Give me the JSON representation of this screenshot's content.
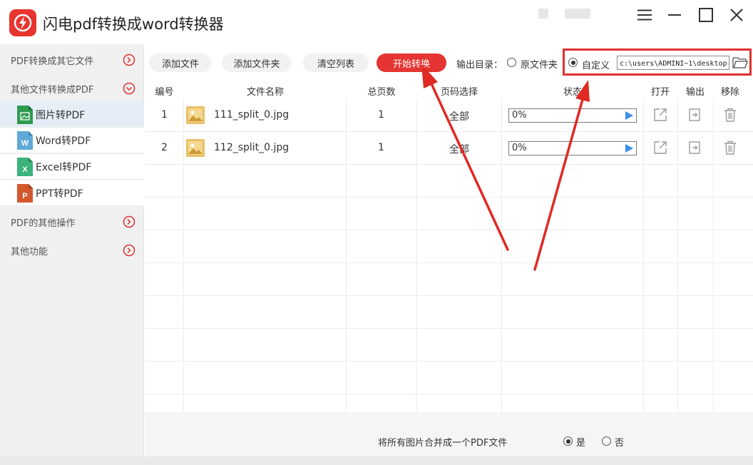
{
  "app": {
    "title": "闪电pdf转换成word转换器",
    "accent_color": "#e43532",
    "window_controls": [
      "menu-icon",
      "minimize-icon",
      "maximize-icon",
      "close-icon"
    ]
  },
  "sidebar": {
    "categories": [
      {
        "label": "PDF转换成其它文件",
        "expanded": false
      },
      {
        "label": "其他文件转换成PDF",
        "expanded": true
      },
      {
        "label": "PDF的其他操作",
        "expanded": false
      },
      {
        "label": "其他功能",
        "expanded": false
      }
    ],
    "sub_items": [
      {
        "label": "图片转PDF",
        "icon": "image-file-icon",
        "icon_letter": "",
        "color": "#2e9a4f",
        "active": true
      },
      {
        "label": "Word转PDF",
        "icon": "word-file-icon",
        "icon_letter": "W",
        "color": "#5fa9d8",
        "active": false
      },
      {
        "label": "Excel转PDF",
        "icon": "excel-file-icon",
        "icon_letter": "X",
        "color": "#3bb37a",
        "active": false
      },
      {
        "label": "PPT转PDF",
        "icon": "ppt-file-icon",
        "icon_letter": "P",
        "color": "#d3582c",
        "active": false
      }
    ]
  },
  "toolbar": {
    "add_file": "添加文件",
    "add_folder": "添加文件夹",
    "clear_list": "清空列表",
    "start": "开始转换",
    "output_label": "输出目录：",
    "opt_original": "原文件夹",
    "opt_custom": "自定义",
    "path_value": "c:\\users\\ADMINI~1\\desktop",
    "selected_output": "自定义"
  },
  "table": {
    "headers": [
      "编号",
      "文件名称",
      "总页数",
      "页码选择",
      "状态",
      "打开",
      "输出",
      "移除"
    ],
    "rows": [
      {
        "no": "1",
        "name": "111_split_0.jpg",
        "pages": "1",
        "range": "全部",
        "progress": "0%"
      },
      {
        "no": "2",
        "name": "112_split_0.jpg",
        "pages": "1",
        "range": "全部",
        "progress": "0%"
      }
    ]
  },
  "footer": {
    "merge_label": "将所有图片合并成一个PDF文件",
    "yes": "是",
    "no": "否",
    "selected": "是"
  }
}
